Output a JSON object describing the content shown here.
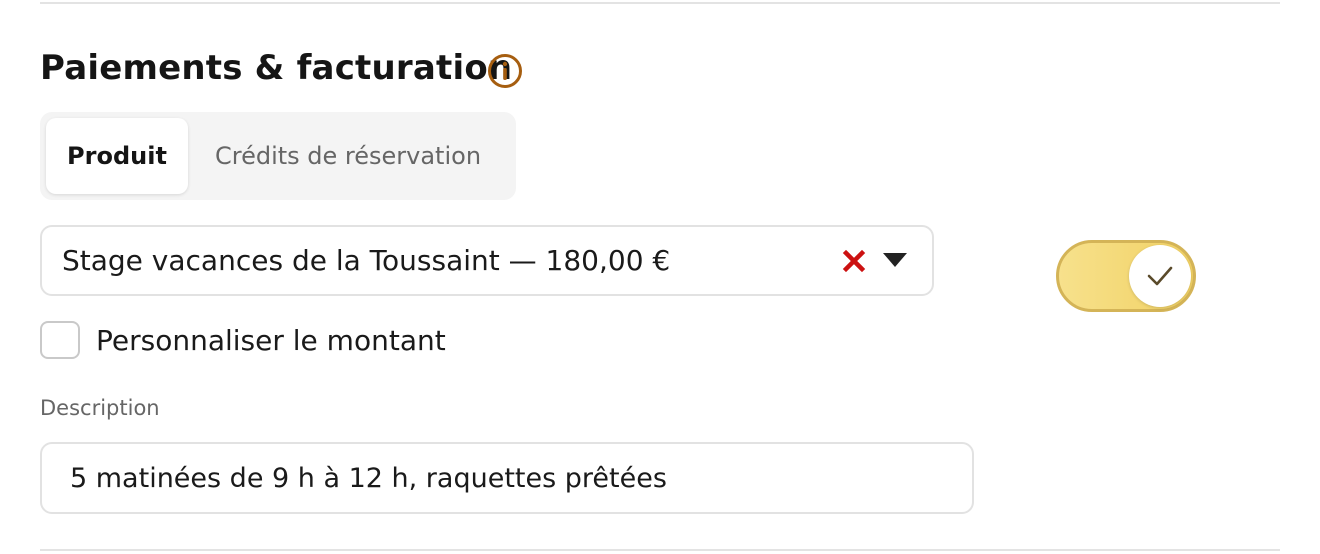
{
  "section": {
    "title": "Paiements & facturation",
    "info_icon": "info-circle-icon"
  },
  "tabs": [
    {
      "label": "Produit",
      "active": true
    },
    {
      "label": "Crédits de réservation",
      "active": false
    }
  ],
  "product_select": {
    "value": "Stage vacances de la Toussaint — 180,00 €",
    "clear_icon": "clear-x-icon",
    "dropdown_icon": "triangle-down-icon"
  },
  "toggle": {
    "checked": true,
    "icon": "check-icon"
  },
  "custom_amount": {
    "label": "Personnaliser le montant",
    "checked": false
  },
  "description": {
    "label": "Description",
    "value": "5 matinées de 9 h à 12 h, raquettes prêtées"
  },
  "colors": {
    "info_accent": "#a65e10",
    "clear_red": "#cc1111",
    "toggle_on": "#f3d66e",
    "toggle_border": "#d4b457"
  }
}
